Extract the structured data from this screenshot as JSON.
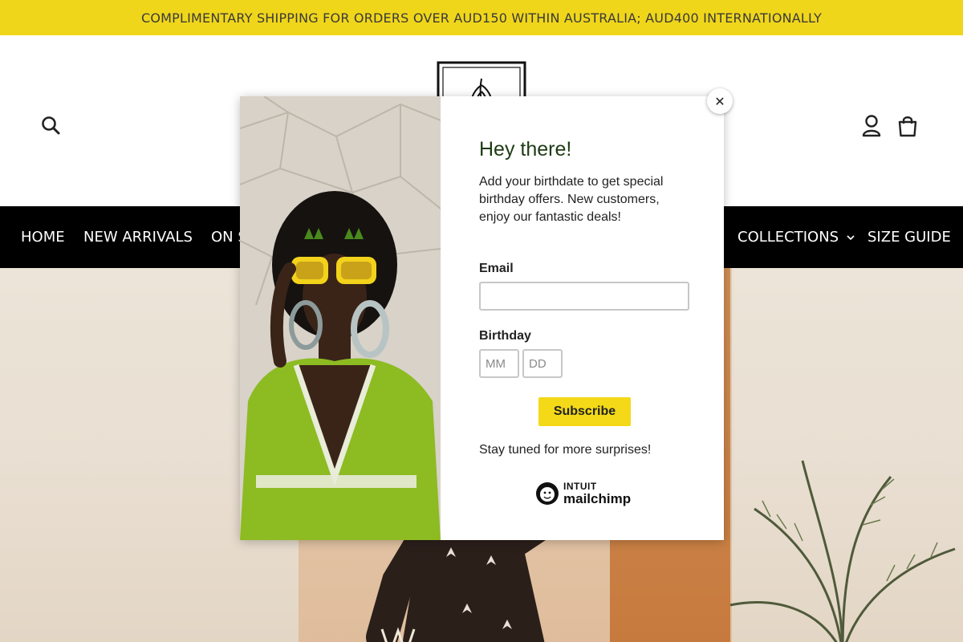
{
  "announcement": {
    "text": "COMPLIMENTARY SHIPPING FOR ORDERS OVER AUD150 WITHIN AUSTRALIA; AUD400 INTERNATIONALLY"
  },
  "header": {
    "search_label": "Submit",
    "account_label": "Log in",
    "cart_label": "Cart"
  },
  "nav": {
    "items": [
      {
        "label": "HOME"
      },
      {
        "label": "NEW ARRIVALS"
      },
      {
        "label": "ON S"
      },
      {
        "label": "COLLECTIONS",
        "has_dropdown": true
      },
      {
        "label": "SIZE GUIDE"
      }
    ]
  },
  "popup": {
    "close_symbol": "✕",
    "title": "Hey there!",
    "description": "Add your birthdate to get special birthday offers. New customers, enjoy our fantastic deals!",
    "email_label": "Email",
    "email_value": "",
    "birthday_label": "Birthday",
    "month_placeholder": "MM",
    "day_placeholder": "DD",
    "subscribe_label": "Subscribe",
    "footer_text": "Stay tuned for more surprises!",
    "badge": {
      "line1": "INTUIT",
      "line2": "mailchimp"
    }
  },
  "colors": {
    "announcement_bg": "#f0d61b",
    "nav_bg": "#000000",
    "subscribe_bg": "#f3d917",
    "title_color": "#1d3b14"
  },
  "icons": [
    "search-icon",
    "logo-icon",
    "account-icon",
    "cart-icon",
    "close-icon",
    "chevron-down-icon",
    "mailchimp-freddie-icon"
  ]
}
